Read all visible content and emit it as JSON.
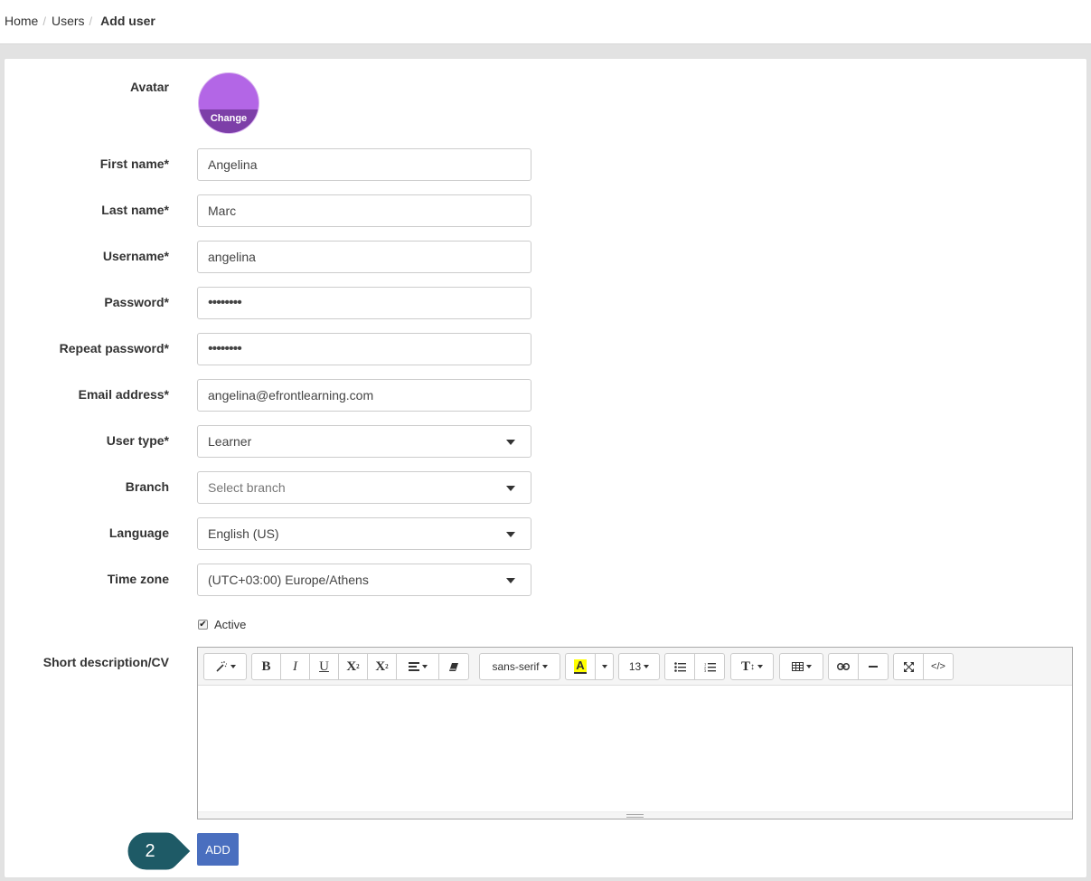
{
  "breadcrumb": {
    "home": "Home",
    "users": "Users",
    "current": "Add user",
    "separator": "/"
  },
  "form": {
    "avatar": {
      "label": "Avatar",
      "change_label": "Change",
      "color": "#b366e6"
    },
    "first_name": {
      "label": "First name*",
      "value": "Angelina"
    },
    "last_name": {
      "label": "Last name*",
      "value": "Marc"
    },
    "username": {
      "label": "Username*",
      "value": "angelina"
    },
    "password": {
      "label": "Password*",
      "value": "••••••••"
    },
    "repeat_password": {
      "label": "Repeat password*",
      "value": "••••••••"
    },
    "email": {
      "label": "Email address*",
      "value": "angelina@efrontlearning.com"
    },
    "user_type": {
      "label": "User type*",
      "value": "Learner"
    },
    "branch": {
      "label": "Branch",
      "placeholder": "Select branch"
    },
    "language": {
      "label": "Language",
      "value": "English (US)"
    },
    "time_zone": {
      "label": "Time zone",
      "value": "(UTC+03:00) Europe/Athens"
    },
    "active": {
      "label": "Active",
      "checked": true,
      "check_glyph": "✔"
    },
    "description": {
      "label": "Short description/CV"
    }
  },
  "editor_toolbar": {
    "style_icon": "magic-wand-icon",
    "bold": "B",
    "italic": "I",
    "underline": "U",
    "superscript": "X",
    "subscript": "X",
    "align_icon": "align-icon",
    "eraser_icon": "eraser-icon",
    "font_family": "sans-serif",
    "highlight_letter": "A",
    "highlight_color": "#ffff00",
    "font_size": "13",
    "ul_icon": "unordered-list-icon",
    "ol_icon": "ordered-list-icon",
    "line_height": "T",
    "table_icon": "table-icon",
    "link_icon": "link-icon",
    "hr_icon": "horizontal-rule-icon",
    "fullscreen_icon": "fullscreen-icon",
    "code_view": "</>"
  },
  "actions": {
    "add_label": "ADD",
    "add_color": "#4a6fbf"
  },
  "step_marker": {
    "number": "2",
    "color": "#1e5a66"
  }
}
